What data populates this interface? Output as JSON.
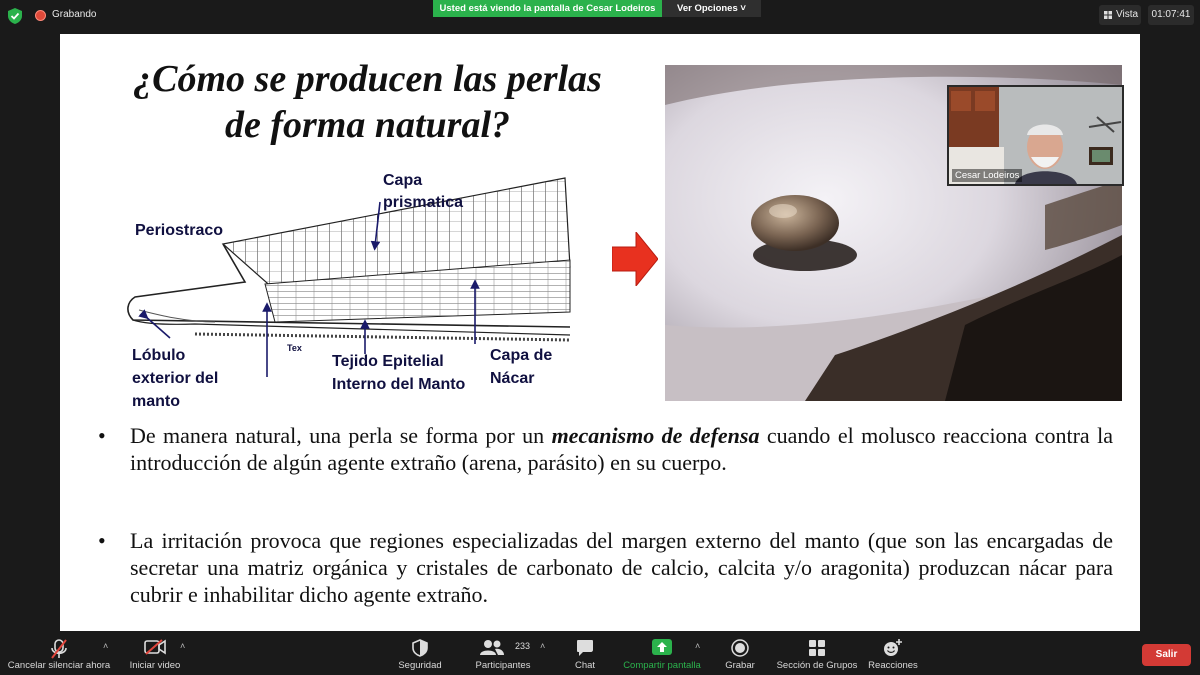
{
  "top_bar": {
    "recording_label": "Grabando",
    "share_banner": "Usted está viendo la pantalla de Cesar Lodeiros",
    "view_options": "Ver Opciones",
    "view_label": "Vista",
    "clock": "01:07:41"
  },
  "slide": {
    "title_line1": "¿Cómo se producen las perlas",
    "title_line2": "de forma natural?",
    "diagram_labels": {
      "capa_prismatica_1": "Capa",
      "capa_prismatica_2": "prismatica",
      "periostraco": "Periostraco",
      "lobulo_1": "Lóbulo",
      "lobulo_2": "exterior del",
      "lobulo_3": "manto",
      "tex": "Tex",
      "tejido_1": "Tejido Epitelial",
      "tejido_2": "Interno del Manto",
      "nacar_1": "Capa de",
      "nacar_2": "Nácar"
    },
    "bullet1_pre": "De manera natural, una perla se forma por un ",
    "bullet1_emph": "mecanismo de defensa",
    "bullet1_post": " cuando el molusco reacciona contra la introducción de algún agente extraño (arena, parásito) en su cuerpo.",
    "bullet2": "La irritación provoca que regiones especializadas del margen externo del manto (que son las encargadas de secretar una matriz orgánica y cristales de carbonato de calcio, calcita y/o aragonita) produzcan nácar para cubrir e inhabilitar dicho agente extraño.",
    "bullet_symbol": "•"
  },
  "webcam": {
    "name": "Cesar Lodeiros"
  },
  "toolbar": {
    "mute": "Cancelar silenciar ahora",
    "video": "Iniciar video",
    "security": "Seguridad",
    "participants": "Participantes",
    "participants_count": "233",
    "chat": "Chat",
    "share": "Compartir pantalla",
    "record": "Grabar",
    "breakout": "Sección de Grupos",
    "reactions": "Reacciones",
    "leave": "Salir"
  },
  "colors": {
    "share_green": "#2bb24c",
    "leave_red": "#d33a35",
    "arrow_red": "#e8311f"
  }
}
